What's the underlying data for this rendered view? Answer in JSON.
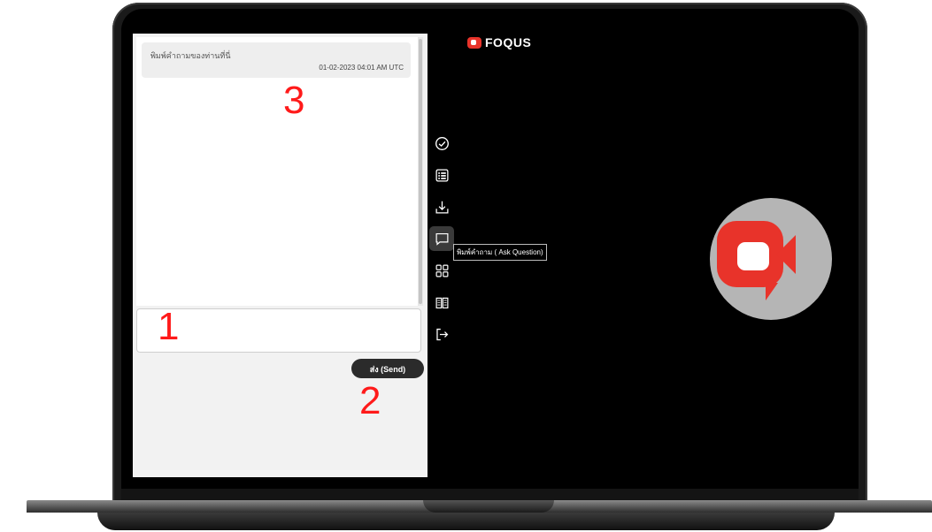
{
  "chat": {
    "message_text": "พิมพ์คำถามของท่านที่นี่",
    "message_time": "01-02-2023 04:01 AM UTC",
    "input_value": "",
    "send_label": "ส่ง (Send)"
  },
  "annotations": {
    "one": "1",
    "two": "2",
    "three": "3"
  },
  "brand": {
    "name": "FOQUS",
    "color": "#e8332a"
  },
  "toolbar": {
    "items": [
      "check-circle-icon",
      "list-icon",
      "download-icon",
      "chat-icon",
      "grid-icon",
      "book-icon",
      "exit-icon"
    ],
    "active": "chat-icon"
  },
  "tooltip": {
    "text": "พิมพ์คำถาม ( Ask Question)"
  }
}
